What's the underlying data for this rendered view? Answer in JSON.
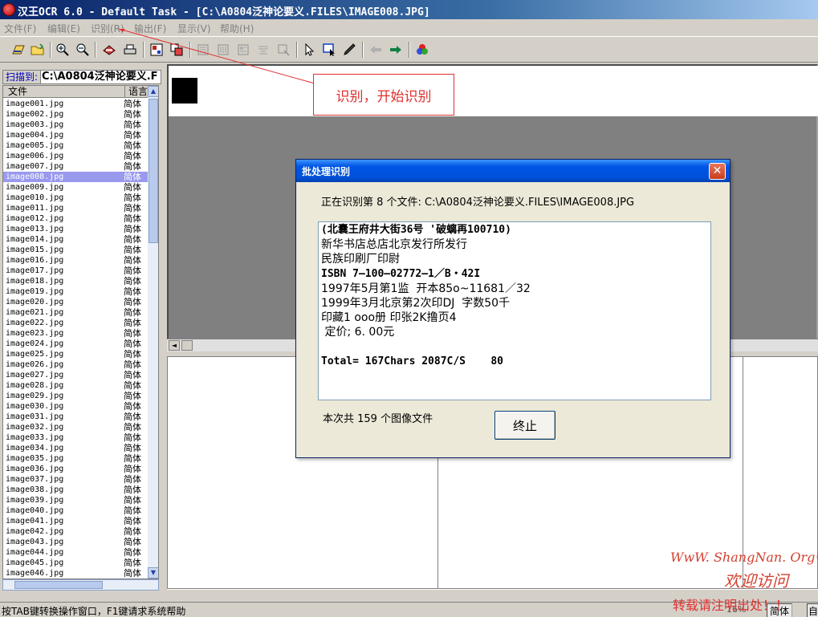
{
  "window": {
    "title": "汉王OCR 6.0 - Default Task - [C:\\A0804泛神论要义.FILES\\IMAGE008.JPG]"
  },
  "menu": [
    {
      "label": "文件(F)"
    },
    {
      "label": "编辑(E)"
    },
    {
      "label": "识别(R)"
    },
    {
      "label": "输出(F)"
    },
    {
      "label": "显示(V)"
    },
    {
      "label": "帮助(H)"
    }
  ],
  "toolbar": {
    "icons": [
      "open-scan-icon",
      "open-folder-icon",
      "zoom-in-icon",
      "zoom-out-icon",
      "scan-icon",
      "scanner-icon",
      "layout-icon",
      "copy-region-icon",
      "region-a-icon",
      "region-b-icon",
      "region-c-icon",
      "region-d-icon",
      "region-e-icon",
      "select-arrow-icon",
      "select-box-icon",
      "pen-icon",
      "back-arrow-icon",
      "forward-arrow-icon",
      "color-icon"
    ]
  },
  "left_panel": {
    "scan_label": "扫描到:",
    "path": "C:\\A0804泛神论要义.F",
    "columns": {
      "file": "文件",
      "language": "语言"
    },
    "selected_file": "image008.jpg",
    "files": [
      {
        "name": "image001.jpg",
        "lang": "简体"
      },
      {
        "name": "image002.jpg",
        "lang": "简体"
      },
      {
        "name": "image003.jpg",
        "lang": "简体"
      },
      {
        "name": "image004.jpg",
        "lang": "简体"
      },
      {
        "name": "image005.jpg",
        "lang": "简体"
      },
      {
        "name": "image006.jpg",
        "lang": "简体"
      },
      {
        "name": "image007.jpg",
        "lang": "简体"
      },
      {
        "name": "image008.jpg",
        "lang": "简体"
      },
      {
        "name": "image009.jpg",
        "lang": "简体"
      },
      {
        "name": "image010.jpg",
        "lang": "简体"
      },
      {
        "name": "image011.jpg",
        "lang": "简体"
      },
      {
        "name": "image012.jpg",
        "lang": "简体"
      },
      {
        "name": "image013.jpg",
        "lang": "简体"
      },
      {
        "name": "image014.jpg",
        "lang": "简体"
      },
      {
        "name": "image015.jpg",
        "lang": "简体"
      },
      {
        "name": "image016.jpg",
        "lang": "简体"
      },
      {
        "name": "image017.jpg",
        "lang": "简体"
      },
      {
        "name": "image018.jpg",
        "lang": "简体"
      },
      {
        "name": "image019.jpg",
        "lang": "简体"
      },
      {
        "name": "image020.jpg",
        "lang": "简体"
      },
      {
        "name": "image021.jpg",
        "lang": "简体"
      },
      {
        "name": "image022.jpg",
        "lang": "简体"
      },
      {
        "name": "image023.jpg",
        "lang": "简体"
      },
      {
        "name": "image024.jpg",
        "lang": "简体"
      },
      {
        "name": "image025.jpg",
        "lang": "简体"
      },
      {
        "name": "image026.jpg",
        "lang": "简体"
      },
      {
        "name": "image027.jpg",
        "lang": "简体"
      },
      {
        "name": "image028.jpg",
        "lang": "简体"
      },
      {
        "name": "image029.jpg",
        "lang": "简体"
      },
      {
        "name": "image030.jpg",
        "lang": "简体"
      },
      {
        "name": "image031.jpg",
        "lang": "简体"
      },
      {
        "name": "image032.jpg",
        "lang": "简体"
      },
      {
        "name": "image033.jpg",
        "lang": "简体"
      },
      {
        "name": "image034.jpg",
        "lang": "简体"
      },
      {
        "name": "image035.jpg",
        "lang": "简体"
      },
      {
        "name": "image036.jpg",
        "lang": "简体"
      },
      {
        "name": "image037.jpg",
        "lang": "简体"
      },
      {
        "name": "image038.jpg",
        "lang": "简体"
      },
      {
        "name": "image039.jpg",
        "lang": "简体"
      },
      {
        "name": "image040.jpg",
        "lang": "简体"
      },
      {
        "name": "image041.jpg",
        "lang": "简体"
      },
      {
        "name": "image042.jpg",
        "lang": "简体"
      },
      {
        "name": "image043.jpg",
        "lang": "简体"
      },
      {
        "name": "image044.jpg",
        "lang": "简体"
      },
      {
        "name": "image045.jpg",
        "lang": "简体"
      },
      {
        "name": "image046.jpg",
        "lang": "简体"
      }
    ]
  },
  "callout": {
    "text": "识别，开始识别"
  },
  "dialog": {
    "title": "批处理识别",
    "close_label": "✕",
    "progress_text": "正在识别第 8 个文件:  C:\\A0804泛神论要义.FILES\\IMAGE008.JPG",
    "result_lines": [
      "(北囊王府井大街36号 '破螭再100710)",
      "新华书店总店北京发行所发行",
      "民族印刷厂印尉",
      "ISBN 7—100—02772—1／B・42I",
      "1997年5月第1监  开本85o~11681／32",
      "1999年3月北京第2次印DJ  字数50千",
      "印藏1 ooo册 印张2K撸页4",
      " 定价; 6. 00元",
      "",
      "Total= 167Chars 2087C/S    80"
    ],
    "count_text": "本次共 159 个图像文件",
    "stop_label": "终止"
  },
  "status": {
    "text": "按TAB键转换操作窗口，F1键请求系统帮助",
    "zoom": "16%",
    "language": "简体",
    "extra": "自"
  },
  "watermark": {
    "line1": "WwW. ShangNan. Org®",
    "line2": "欢迎访问",
    "line3": "转载请注明出处！！"
  }
}
